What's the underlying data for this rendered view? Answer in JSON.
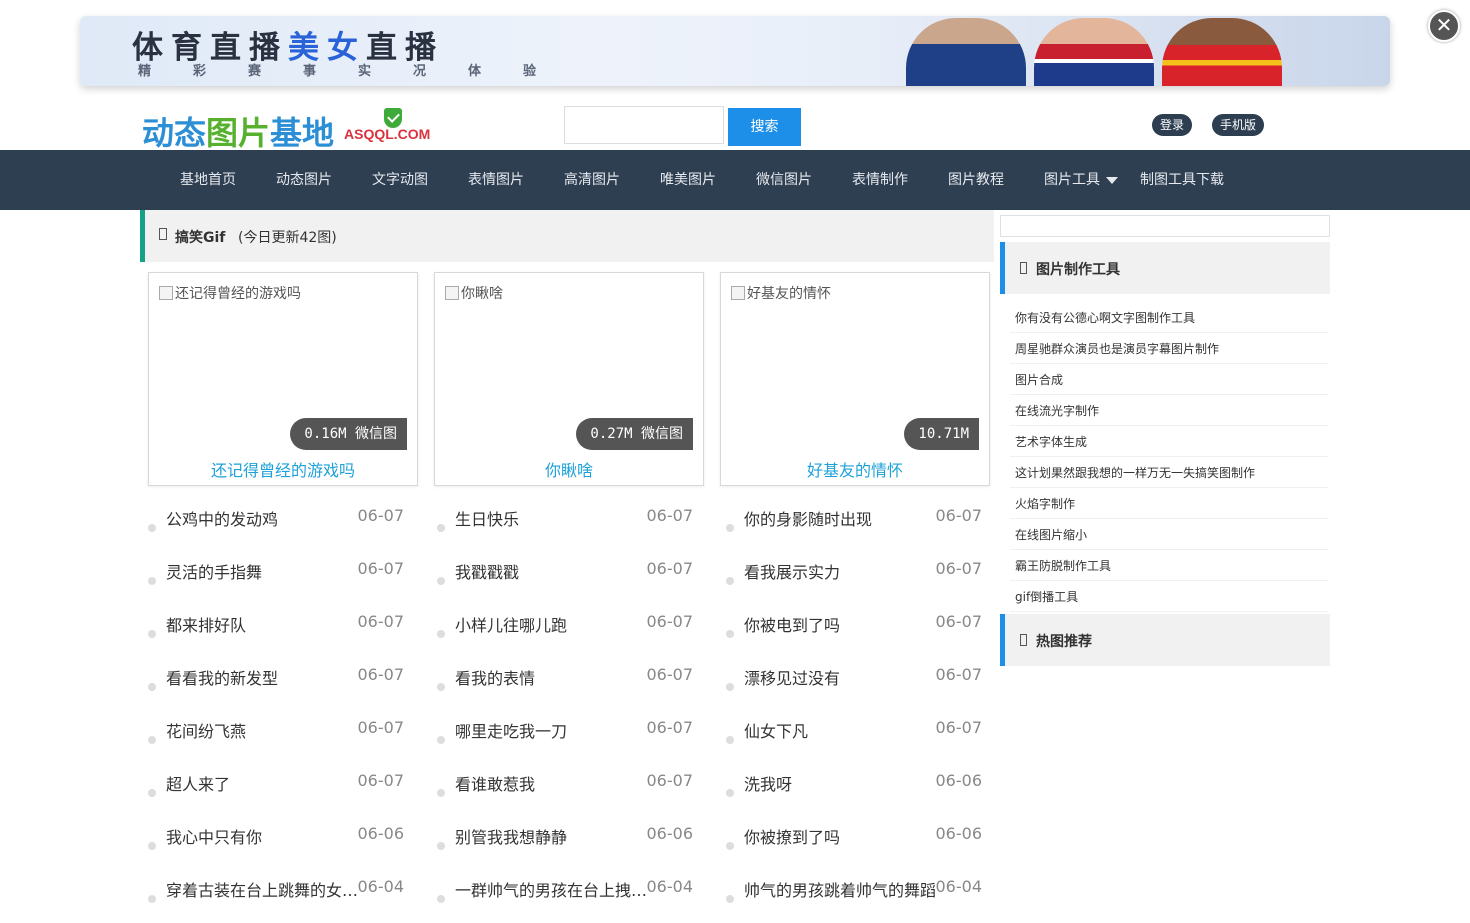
{
  "banner": {
    "title_part1": "体育直播",
    "title_part2": "美女",
    "title_part3": "直播",
    "subtitle": "精彩赛事实况体验"
  },
  "header": {
    "logo_part1": "动态",
    "logo_part2": "图片",
    "logo_part3": "基地",
    "logo_url": "ASQQL.COM",
    "search_placeholder": "",
    "search_button": "搜索",
    "login": "登录",
    "mobile": "手机版"
  },
  "nav": {
    "items": [
      "基地首页",
      "动态图片",
      "文字动图",
      "表情图片",
      "高清图片",
      "唯美图片",
      "微信图片",
      "表情制作",
      "图片教程",
      "图片工具",
      "制图工具下载"
    ]
  },
  "section": {
    "title": "搞笑Gif",
    "note": "(今日更新42图)"
  },
  "cards": [
    {
      "alt": "还记得曾经的游戏吗",
      "badge": "0.16M 微信图",
      "caption": "还记得曾经的游戏吗"
    },
    {
      "alt": "你瞅啥",
      "badge": "0.27M 微信图",
      "caption": "你瞅啥"
    },
    {
      "alt": "好基友的情怀",
      "badge": "10.71M",
      "caption": "好基友的情怀"
    }
  ],
  "lists": [
    [
      {
        "title": "公鸡中的发动鸡",
        "date": "06-07"
      },
      {
        "title": "灵活的手指舞",
        "date": "06-07"
      },
      {
        "title": "都来排好队",
        "date": "06-07"
      },
      {
        "title": "看看我的新发型",
        "date": "06-07"
      },
      {
        "title": "花间纷飞燕",
        "date": "06-07"
      },
      {
        "title": "超人来了",
        "date": "06-07"
      },
      {
        "title": "我心中只有你",
        "date": "06-06"
      },
      {
        "title": "穿着古装在台上跳舞的女孩子",
        "date": "06-04"
      }
    ],
    [
      {
        "title": "生日快乐",
        "date": "06-07"
      },
      {
        "title": "我戳戳戳",
        "date": "06-07"
      },
      {
        "title": "小样儿往哪儿跑",
        "date": "06-07"
      },
      {
        "title": "看我的表情",
        "date": "06-07"
      },
      {
        "title": "哪里走吃我一刀",
        "date": "06-07"
      },
      {
        "title": "看谁敢惹我",
        "date": "06-07"
      },
      {
        "title": "别管我我想静静",
        "date": "06-06"
      },
      {
        "title": "一群帅气的男孩在台上拽拽的",
        "date": "06-04"
      }
    ],
    [
      {
        "title": "你的身影随时出现",
        "date": "06-07"
      },
      {
        "title": "看我展示实力",
        "date": "06-07"
      },
      {
        "title": "你被电到了吗",
        "date": "06-07"
      },
      {
        "title": "漂移见过没有",
        "date": "06-07"
      },
      {
        "title": "仙女下凡",
        "date": "06-07"
      },
      {
        "title": "洗我呀",
        "date": "06-06"
      },
      {
        "title": "你被撩到了吗",
        "date": "06-06"
      },
      {
        "title": "帅气的男孩跳着帅气的舞蹈",
        "date": "06-04"
      }
    ]
  ],
  "sidebar": {
    "tools_title": "图片制作工具",
    "tools": [
      "你有没有公德心啊文字图制作工具",
      "周星驰群众演员也是演员字幕图片制作",
      "图片合成",
      "在线流光字制作",
      "艺术字体生成",
      "这计划果然跟我想的一样万无一失搞笑图制作",
      "火焰字制作",
      "在线图片缩小",
      "霸王防脱制作工具",
      "gif倒播工具"
    ],
    "hot_title": "热图推荐"
  }
}
